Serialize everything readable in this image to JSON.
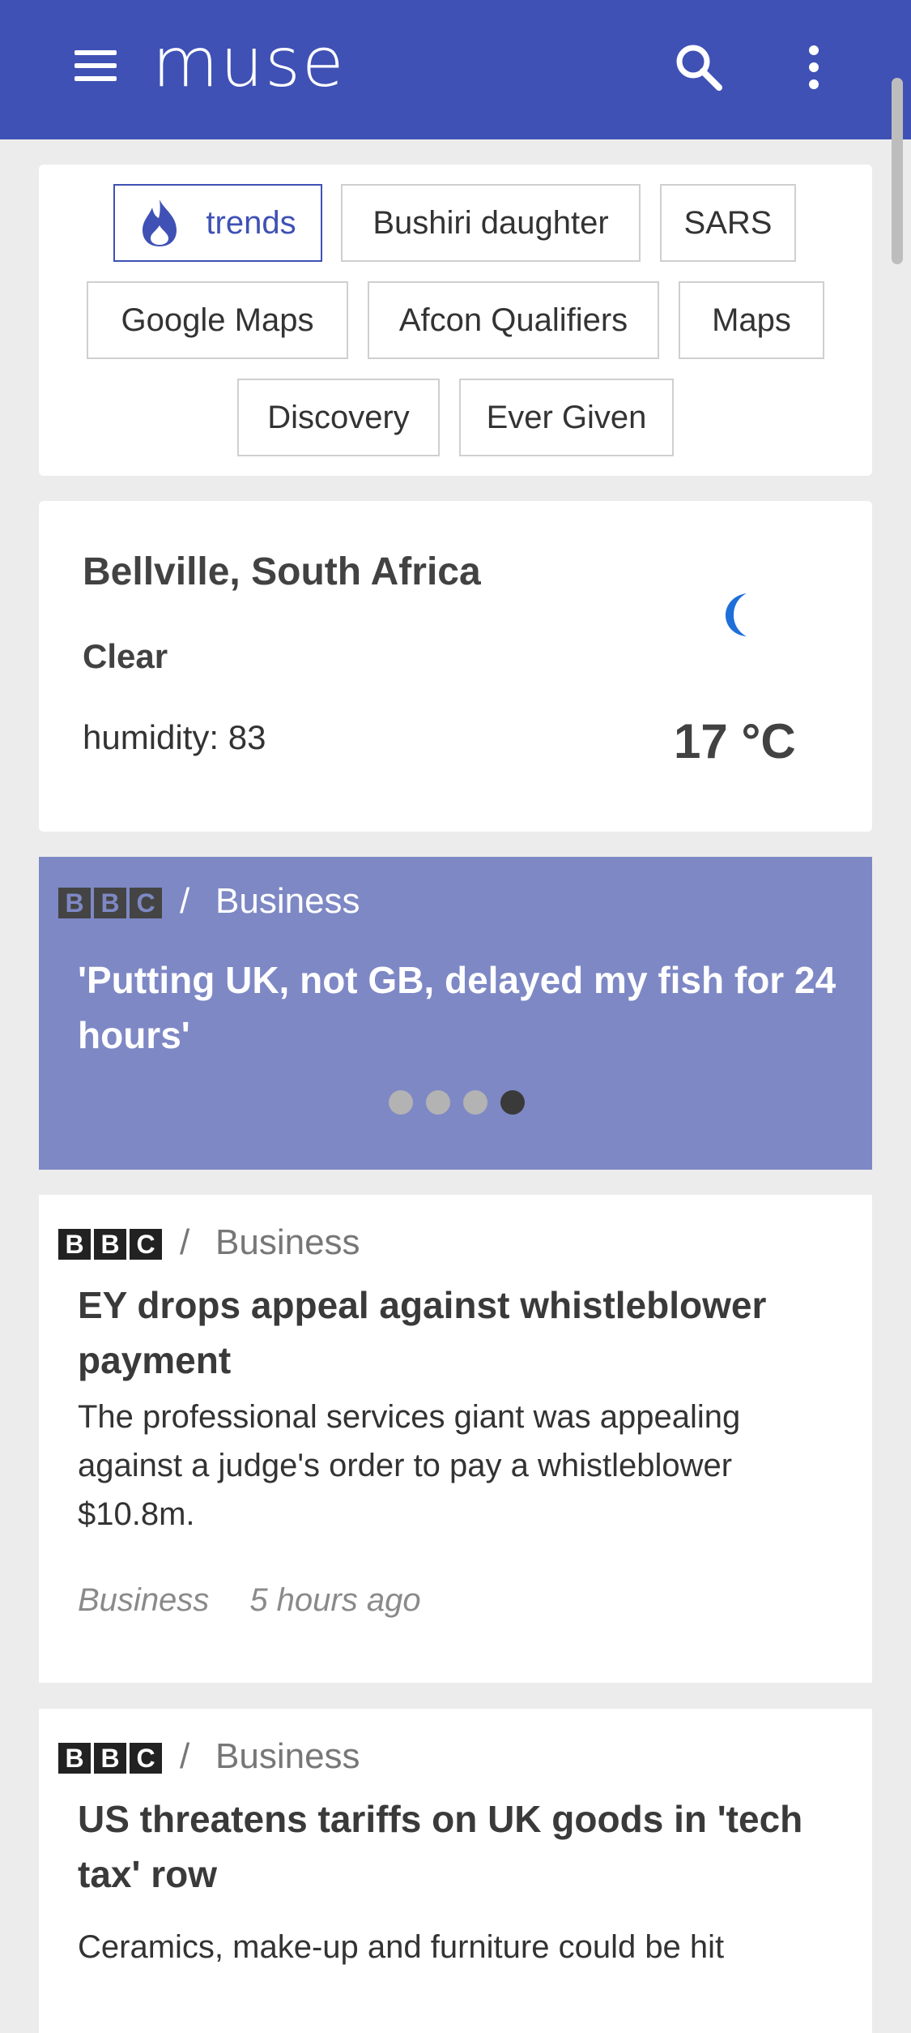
{
  "app": {
    "name": "muse",
    "brand_color": "#3f51b5",
    "icons": [
      "menu-icon",
      "search-icon",
      "more-vert-icon"
    ]
  },
  "trends": {
    "chips": [
      {
        "label": "trends",
        "icon": "flame-icon",
        "active": true
      },
      {
        "label": "Bushiri daughter"
      },
      {
        "label": "SARS"
      },
      {
        "label": "Google Maps"
      },
      {
        "label": "Afcon Qualifiers"
      },
      {
        "label": "Maps"
      },
      {
        "label": "Discovery"
      },
      {
        "label": "Ever Given"
      }
    ]
  },
  "weather": {
    "location": "Bellville, South Africa",
    "condition": "Clear",
    "humidity": "humidity: 83",
    "temperature": "17 °C",
    "icon": "moon-icon"
  },
  "featured": {
    "source_logo": "BBC",
    "separator": "/",
    "category": "Business",
    "title": "'Putting UK, not GB, delayed my fish for 24 hours'",
    "slide_count": 4,
    "active_slide": 4
  },
  "articles": [
    {
      "source_logo": "BBC",
      "separator": "/",
      "category": "Business",
      "title": "EY drops appeal against whistleblower payment",
      "description": "The professional services giant was appealing against a judge's order to pay a whistleblower $10.8m.",
      "tag": "Business",
      "time": "5 hours ago"
    },
    {
      "source_logo": "BBC",
      "separator": "/",
      "category": "Business",
      "title": "US threatens tariffs on UK goods in 'tech tax' row",
      "description": "Ceramics, make-up and furniture could be hit"
    }
  ]
}
